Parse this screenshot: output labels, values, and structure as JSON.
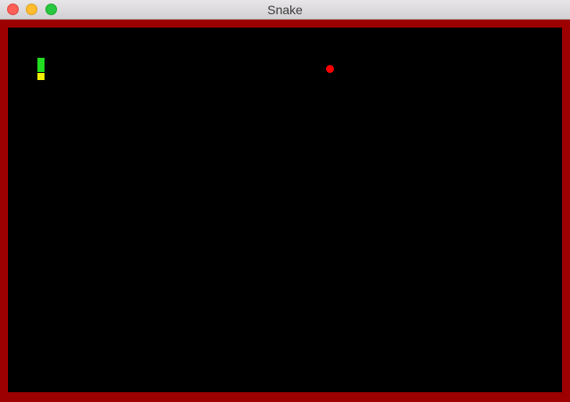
{
  "window": {
    "title": "Snake"
  },
  "colors": {
    "border": "#9c0000",
    "background": "#000000",
    "snake_body": "#22dd22",
    "snake_head": "#f0f000",
    "food": "#ff0000"
  },
  "game": {
    "snake": [
      {
        "part": "body",
        "color": "#22dd22"
      },
      {
        "part": "body",
        "color": "#22dd22"
      },
      {
        "part": "head",
        "color": "#f0f000"
      }
    ],
    "food": {
      "color": "#ff0000"
    }
  }
}
